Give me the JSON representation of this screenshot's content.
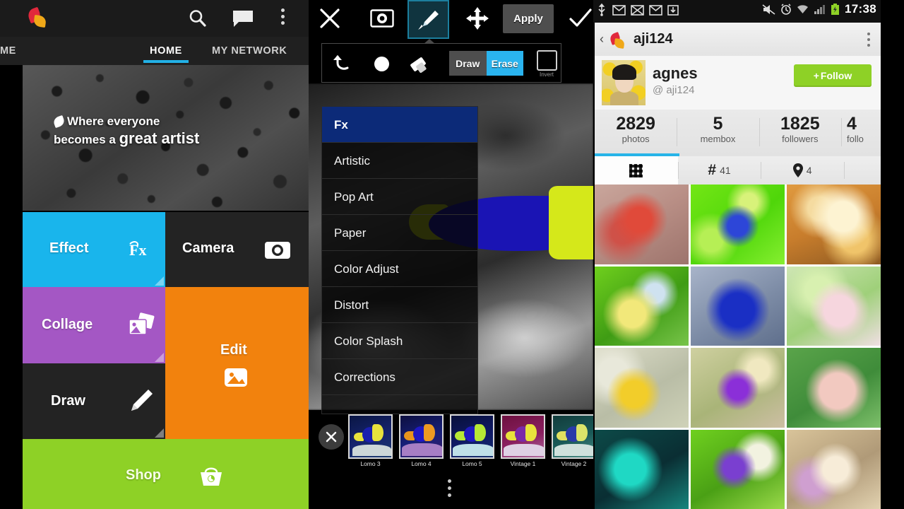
{
  "panel_left": {
    "actionbar": {
      "logo_name": "picsart-logo",
      "search_label": "search-icon",
      "chat_label": "chat-icon",
      "overflow_label": "overflow-menu-icon"
    },
    "tabs": [
      {
        "label": "ME",
        "active": false
      },
      {
        "label": "HOME",
        "active": true
      },
      {
        "label": "MY NETWORK",
        "active": false
      }
    ],
    "hero": {
      "line1": "Where everyone",
      "line2_prefix": "becomes a ",
      "line2_strong": "great artist"
    },
    "tiles": [
      {
        "label": "Effect",
        "color": "#19b5ec",
        "icon": "fx-icon"
      },
      {
        "label": "Camera",
        "color": "#232323",
        "icon": "camera-icon"
      },
      {
        "label": "Collage",
        "color": "#a457c4",
        "icon": "collage-icon"
      },
      {
        "label": "Edit",
        "color": "#f2820d",
        "icon": "edit-photo-icon"
      },
      {
        "label": "Draw",
        "color": "#232323",
        "icon": "pencil-icon"
      },
      {
        "label": "Shop",
        "color": "#8ed126",
        "icon": "shopping-basket-icon"
      }
    ]
  },
  "panel_middle": {
    "toolbar": {
      "close_label": "close-icon",
      "camera_label": "camera-icon",
      "brush_label": "brush-icon",
      "move_label": "move-icon",
      "apply_label": "Apply",
      "confirm_label": "check-icon"
    },
    "brush_bar": {
      "undo_label": "undo-icon",
      "brush_dot_label": "brush-size-icon",
      "eraser_label": "eraser-icon",
      "draw_label": "Draw",
      "erase_label": "Erase",
      "erase_active": true,
      "invert_label": "Invert"
    },
    "effect_categories": [
      {
        "label": "Fx",
        "selected": true
      },
      {
        "label": "Artistic",
        "selected": false
      },
      {
        "label": "Pop Art",
        "selected": false
      },
      {
        "label": "Paper",
        "selected": false
      },
      {
        "label": "Color Adjust",
        "selected": false
      },
      {
        "label": "Distort",
        "selected": false
      },
      {
        "label": "Color Splash",
        "selected": false
      },
      {
        "label": "Corrections",
        "selected": false
      }
    ],
    "thumbnails": [
      {
        "label": "Lomo 3"
      },
      {
        "label": "Lomo 4"
      },
      {
        "label": "Lomo 5"
      },
      {
        "label": "Vintage 1"
      },
      {
        "label": "Vintage 2"
      }
    ],
    "tray_close_label": "close-tray-icon",
    "overflow_label": "overflow-menu-icon",
    "accent_blue": "#2ab4ef"
  },
  "panel_right": {
    "statusbar": {
      "icons": [
        "usb-icon",
        "mail-icon",
        "message-icon",
        "mail-icon",
        "download-icon"
      ],
      "right_icons": [
        "mute-icon",
        "alarm-icon",
        "wifi-icon",
        "signal-icon",
        "battery-icon"
      ],
      "time": "17:38"
    },
    "actionbar": {
      "back_label": "back-chevron-icon",
      "logo_label": "picsart-logo",
      "title": "aji124",
      "overflow_label": "overflow-menu-icon"
    },
    "profile": {
      "avatar_label": "user-avatar",
      "name": "agnes",
      "handle": "@ aji124",
      "follow_label": "Follow",
      "follow_plus": "+",
      "follow_color": "#8ed126"
    },
    "stats": [
      {
        "value": "2829",
        "label": "photos"
      },
      {
        "value": "5",
        "label": "membox"
      },
      {
        "value": "1825",
        "label": "followers"
      },
      {
        "value": "4",
        "label": "follo"
      }
    ],
    "tabs": [
      {
        "icon": "grid-icon",
        "count": "",
        "active": true
      },
      {
        "icon": "hash-icon",
        "count": "41",
        "active": false
      },
      {
        "icon": "location-pin-icon",
        "count": "4",
        "active": false
      },
      {
        "icon": "more-icon",
        "count": "",
        "active": false
      }
    ],
    "grid_cells": [
      {
        "name": "photo-red-flower"
      },
      {
        "name": "photo-blue-bloom-green"
      },
      {
        "name": "photo-daisies"
      },
      {
        "name": "photo-yellow-buds"
      },
      {
        "name": "photo-cornflower"
      },
      {
        "name": "photo-pink-cluster"
      },
      {
        "name": "photo-yellow-blossoms"
      },
      {
        "name": "photo-purple-flower"
      },
      {
        "name": "photo-succulent"
      },
      {
        "name": "photo-teal-foliage"
      },
      {
        "name": "photo-violet-green"
      },
      {
        "name": "photo-cream-bokeh"
      }
    ]
  }
}
